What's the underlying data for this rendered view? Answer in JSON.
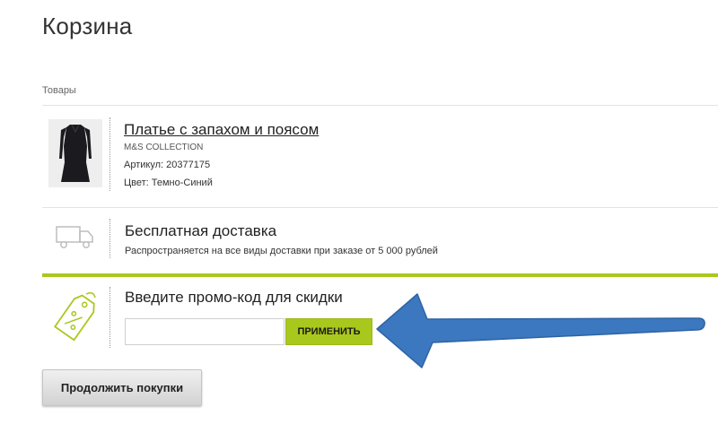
{
  "page": {
    "title": "Корзина"
  },
  "cart": {
    "section_label": "Товары",
    "product": {
      "name": "Платье с запахом и поясом",
      "brand": "M&S COLLECTION",
      "sku": "Артикул: 20377175",
      "color": "Цвет: Темно-Синий",
      "image_icon": "dress-thumbnail"
    }
  },
  "delivery": {
    "icon": "truck-icon",
    "title": "Бесплатная доставка",
    "note": "Распространяется на все виды доставки при заказе от 5 000 рублей"
  },
  "promo": {
    "icon": "discount-tag-icon",
    "title": "Введите промо-код для скидки",
    "input_value": "",
    "apply_label": "ПРИМЕНИТЬ"
  },
  "actions": {
    "continue_label": "Продолжить покупки"
  },
  "colors": {
    "accent": "#a9c81d",
    "annotation_arrow": "#3b78c0"
  }
}
